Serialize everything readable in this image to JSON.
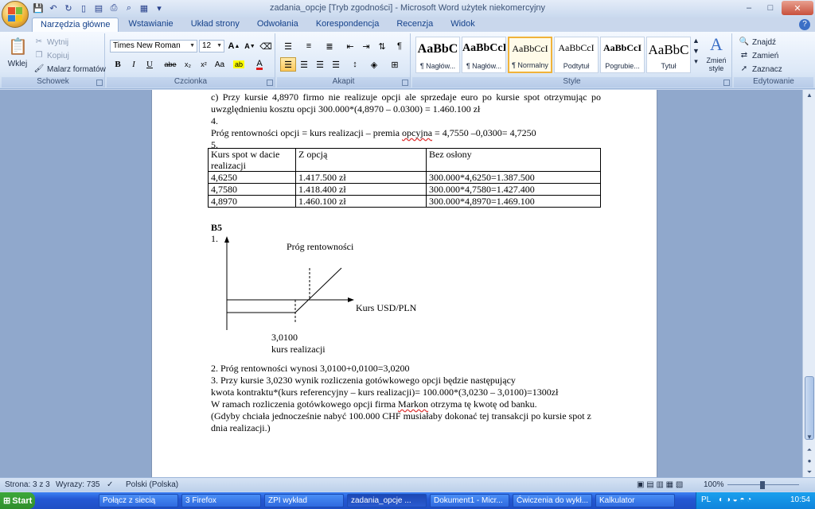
{
  "window": {
    "title": "zadania_opcje [Tryb zgodności] - Microsoft Word użytek niekomercyjny",
    "min": "–",
    "max": "□",
    "close": "✕"
  },
  "ribbon": {
    "tabs": [
      "Narzędzia główne",
      "Wstawianie",
      "Układ strony",
      "Odwołania",
      "Korespondencja",
      "Recenzja",
      "Widok"
    ],
    "help": "?",
    "groups": {
      "clipboard": {
        "label": "Schowek",
        "paste": "Wklej",
        "cut": "Wytnij",
        "copy": "Kopiuj",
        "format_painter": "Malarz formatów"
      },
      "font": {
        "label": "Czcionka",
        "font_name": "Times New Roman",
        "font_size": "12",
        "bold": "B",
        "italic": "I",
        "underline": "U",
        "strike": "abe",
        "sub": "x₂",
        "sup": "x²",
        "case": "Aa",
        "grow": "A",
        "shrink": "A"
      },
      "paragraph": {
        "label": "Akapit"
      },
      "styles": {
        "label": "Style",
        "items": [
          {
            "sample": "AaBbC",
            "name": "¶ Nagłów..."
          },
          {
            "sample": "AaBbCcI",
            "name": "¶ Nagłów..."
          },
          {
            "sample": "AaBbCcI",
            "name": "¶ Normalny"
          },
          {
            "sample": "AaBbCcI",
            "name": "Podtytuł"
          },
          {
            "sample": "AaBbCcI",
            "name": "Pogrubie..."
          },
          {
            "sample": "AaBbC",
            "name": "Tytuł"
          }
        ],
        "change_styles": "Zmień style"
      },
      "editing": {
        "label": "Edytowanie",
        "find": "Znajdź",
        "replace": "Zamień",
        "select": "Zaznacz"
      }
    }
  },
  "document": {
    "para_c": "c) Przy kursie 4,8970 firmo nie realizuje opcji ale sprzedaje euro po kursie spot otrzymując po uwzględnieniu kosztu opcji 300.000*(4,8970 – 0.0300) = 1.460.100 zł",
    "n4": "4.",
    "break_even_pre": "Próg rentowności opcji = kurs realizacji – premia ",
    "break_even_wavy": "opcyjna",
    "break_even_post": " = 4,7550 –0,0300= 4,7250",
    "n5": "5.",
    "table": {
      "headers": [
        "Kurs spot w dacie realizacji",
        "Z opcją",
        "Bez osłony"
      ],
      "rows": [
        [
          "4,6250",
          "1.417.500 zł",
          "300.000*4,6250=1.387.500"
        ],
        [
          "4,7580",
          "1.418.400 zł",
          "300.000*4,7580=1.427.400"
        ],
        [
          "4,8970",
          "1.460.100 zł",
          "300.000*4,8970=1.469.100"
        ]
      ]
    },
    "b5": "B5",
    "b5_n1": "1.",
    "chart": {
      "title": "Próg rentowności",
      "xlabel": "Kurs USD/PLN",
      "strike_value": "3,0100",
      "strike_label": "kurs realizacji"
    },
    "p2": "2. Próg rentowności wynosi 3,0100+0,0100=3,0200",
    "p3a": "3. Przy kursie 3,0230 wynik rozliczenia gotówkowego opcji będzie następujący",
    "p3b": "kwota kontraktu*(kurs referencyjny – kurs realizacji)= 100.000*(3,0230 – 3,0100)=1300zł",
    "p3c_pre": "W ramach rozliczenia gotówkowego opcji firma ",
    "p3c_wavy": "Markon",
    "p3c_post": " otrzyma tę kwotę od banku.",
    "p3d": "(Gdyby chciała jednocześnie nabyć 100.000 CHF musiałaby dokonać tej transakcji po kursie spot z dnia realizacji.)"
  },
  "statusbar": {
    "page": "Strona: 3 z 3",
    "words": "Wyrazy: 735",
    "language": "Polski (Polska)",
    "zoom": "100%"
  },
  "taskbar": {
    "start": "Start",
    "tasks": [
      "Połącz z siecią",
      "3 Firefox",
      "ZPI wykład",
      "zadania_opcje ...",
      "Dokument1 - Micr...",
      "Ćwiczenia do wykł...",
      "Kalkulator"
    ],
    "lang": "PL",
    "clock": "10:54"
  },
  "colors": {
    "accent": "#15428b",
    "ribbon_bg": "#dce8f7",
    "doc_bg": "#90a8cc",
    "taskbar": "#2458d4"
  }
}
